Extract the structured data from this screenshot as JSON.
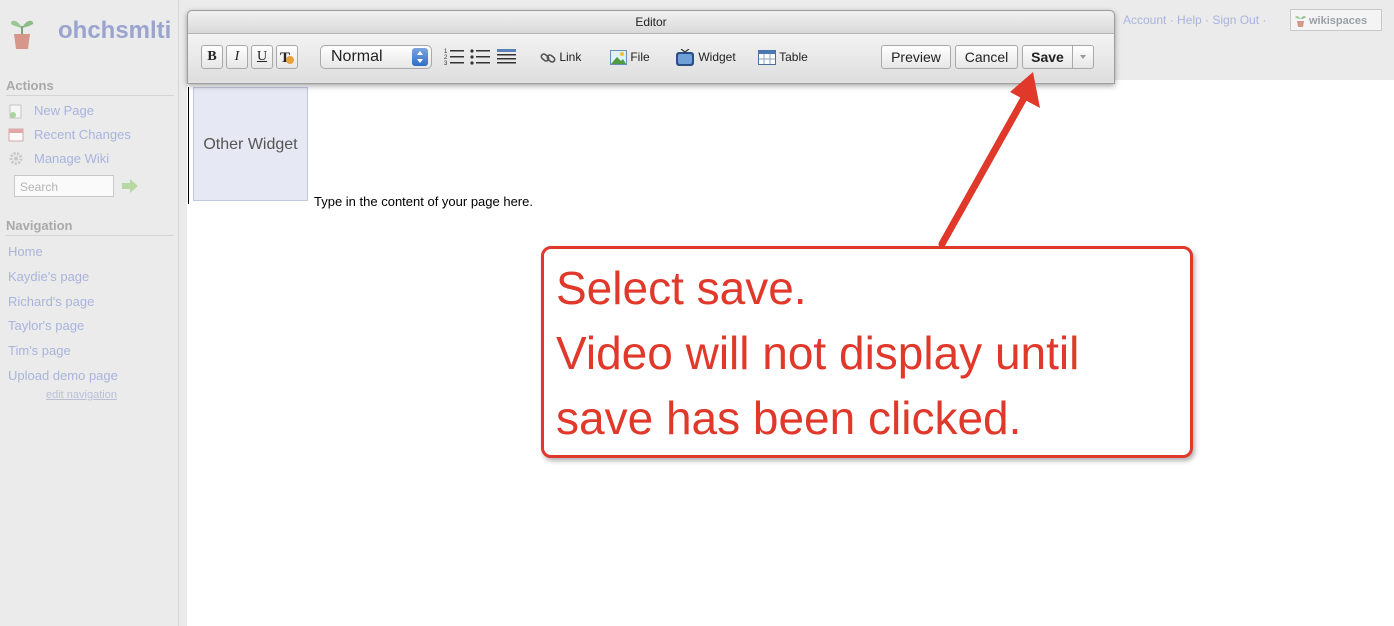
{
  "wiki": {
    "title": "ohchsmlti",
    "actions_heading": "Actions",
    "actions": [
      {
        "label": "New Page",
        "icon": "new-page-icon"
      },
      {
        "label": "Recent Changes",
        "icon": "calendar-icon"
      },
      {
        "label": "Manage Wiki",
        "icon": "gear-icon"
      }
    ],
    "search_placeholder": "Search",
    "navigation_heading": "Navigation",
    "nav_items": [
      "Home",
      "Kaydie's page",
      "Richard's page",
      "Taylor's page",
      "Tim's page",
      "Upload demo page"
    ],
    "edit_navigation": "edit navigation",
    "top_links": "Account · Help · Sign Out ·",
    "brand": "wikispaces"
  },
  "editor": {
    "title": "Editor",
    "format_buttons": [
      "B",
      "I",
      "U"
    ],
    "paragraph_style": "Normal",
    "link_label": "Link",
    "file_label": "File",
    "widget_label": "Widget",
    "table_label": "Table",
    "preview_label": "Preview",
    "cancel_label": "Cancel",
    "save_label": "Save"
  },
  "content": {
    "widget_placeholder": "Other Widget",
    "body_text": "Type in the content of your page here."
  },
  "callout": {
    "lines": [
      "Select save.",
      "Video will not display until",
      "save has been clicked."
    ]
  },
  "colors": {
    "annotation_red": "#e0382a",
    "link_faded": "#a9b4dc"
  }
}
